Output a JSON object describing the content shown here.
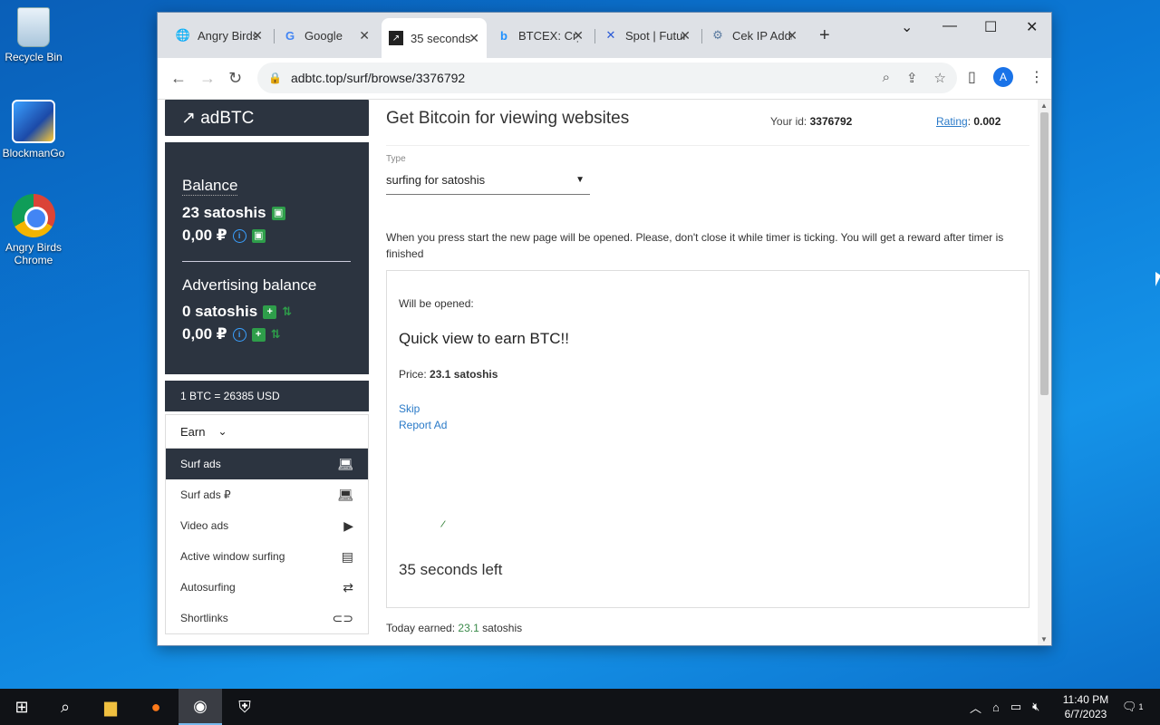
{
  "desktop": {
    "icons": [
      {
        "label": "Recycle Bin"
      },
      {
        "label": "BlockmanGo"
      },
      {
        "label": "Angry Birds Chrome"
      }
    ]
  },
  "browser": {
    "tabs": [
      {
        "title": "Angry Birds",
        "icon": "globe-icon"
      },
      {
        "title": "Google",
        "icon": "google-icon"
      },
      {
        "title": "35 seconds",
        "icon": "arrow-icon",
        "active": true
      },
      {
        "title": "BTCEX: Crypto",
        "icon": "btcex-icon"
      },
      {
        "title": "Spot | Futures",
        "icon": "x-icon"
      },
      {
        "title": "Cek IP Address",
        "icon": "network-icon"
      }
    ],
    "new_tab": "+",
    "url": "adbtc.top/surf/browse/3376792",
    "profile_initial": "A"
  },
  "sidebar": {
    "brand": "↗ adBTC",
    "balance_label": "Balance",
    "balance_sat": "23 satoshis",
    "balance_rub": "0,00 ₽",
    "ad_balance_label": "Advertising balance",
    "ad_balance_sat": "0 satoshis",
    "ad_balance_rub": "0,00 ₽",
    "rate": "1 BTC = 26385 USD",
    "menu_head": "Earn",
    "items": [
      {
        "label": "Surf ads",
        "icon": "laptop-icon",
        "active": true
      },
      {
        "label": "Surf ads ₽",
        "icon": "laptop-icon"
      },
      {
        "label": "Video ads",
        "icon": "video-icon"
      },
      {
        "label": "Active window surfing",
        "icon": "window-icon"
      },
      {
        "label": "Autosurfing",
        "icon": "repeat-icon"
      },
      {
        "label": "Shortlinks",
        "icon": "link-icon"
      }
    ]
  },
  "main": {
    "title": "Get Bitcoin for viewing websites",
    "your_id_label": "Your id:",
    "your_id": "3376792",
    "rating_label": "Rating",
    "rating_value": "0.002",
    "type_label": "Type",
    "type_value": "surfing for satoshis",
    "notice": "When you press start the new page will be opened. Please, don't close it while timer is ticking. You will get a reward after timer is finished",
    "will_be_opened": "Will be opened:",
    "ad_title": "Quick view to earn BTC!!",
    "price_label": "Price:",
    "price_value": "23.1 satoshis",
    "skip": "Skip",
    "report": "Report Ad",
    "seconds_left": "35 seconds left",
    "today_label": "Today earned:",
    "today_value": "23.1",
    "today_unit": "satoshis"
  },
  "taskbar": {
    "time": "11:40 PM",
    "date": "6/7/2023",
    "notifications": "1"
  }
}
